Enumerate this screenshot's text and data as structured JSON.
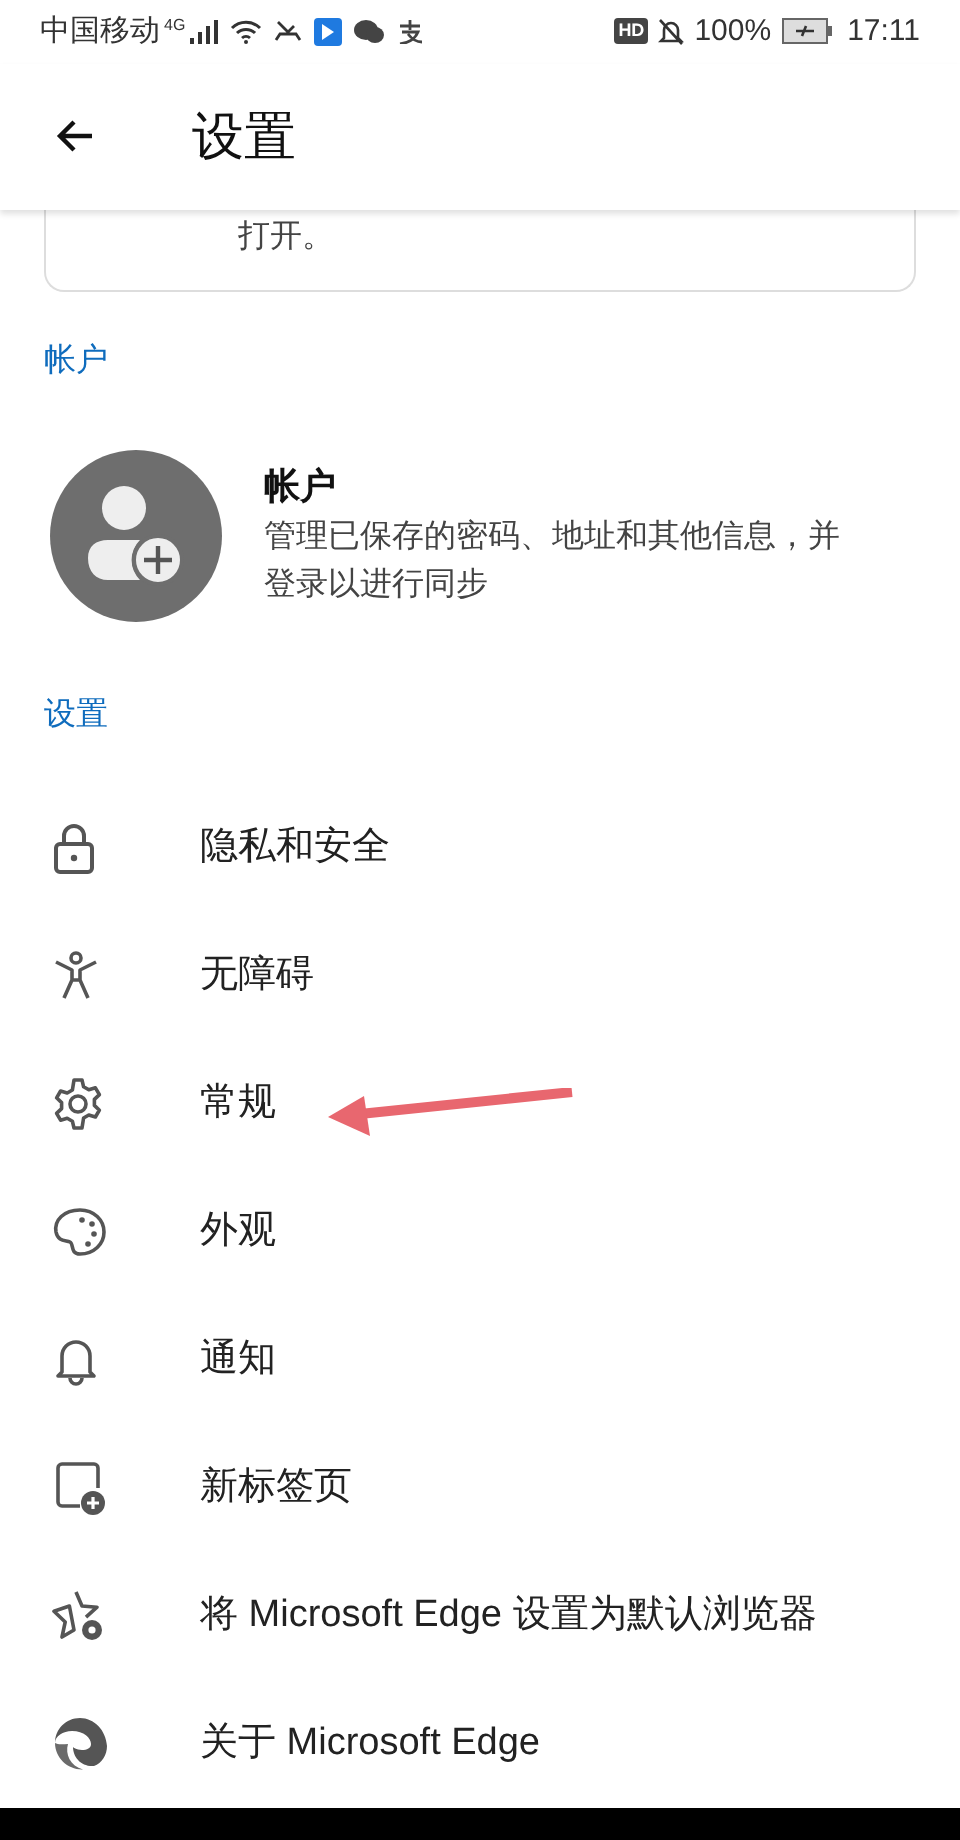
{
  "status_bar": {
    "carrier": "中国移动",
    "network": "4G",
    "hd": "HD",
    "battery": "100%",
    "time": "17:11"
  },
  "app_bar": {
    "title": "设置"
  },
  "card": {
    "text": "打开。"
  },
  "sections": [
    {
      "header": "帐户",
      "kind": "account",
      "title": "帐户",
      "description": "管理已保存的密码、地址和其他信息，并登录以进行同步"
    },
    {
      "header": "设置",
      "kind": "list",
      "items": [
        {
          "kind": "lock",
          "label": "隐私和安全"
        },
        {
          "kind": "accessibility",
          "label": "无障碍"
        },
        {
          "kind": "gear",
          "label": "常规",
          "annotated": true
        },
        {
          "kind": "palette",
          "label": "外观"
        },
        {
          "kind": "bell",
          "label": "通知"
        },
        {
          "kind": "newtab",
          "label": "新标签页"
        },
        {
          "kind": "star",
          "label": "将 Microsoft Edge 设置为默认浏览器"
        },
        {
          "kind": "edge",
          "label": "关于 Microsoft Edge"
        }
      ]
    }
  ]
}
